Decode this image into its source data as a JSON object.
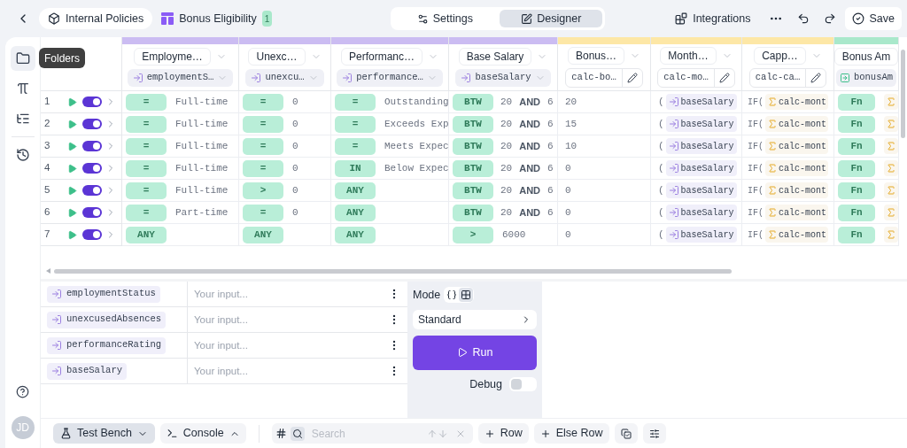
{
  "header": {
    "breadcrumbs": [
      {
        "label": "Internal Policies",
        "kind": "folder"
      },
      {
        "label": "Bonus Eligibility",
        "kind": "table",
        "badge": "1"
      }
    ],
    "tabs": [
      {
        "label": "Settings",
        "kind": "settings",
        "selected": false
      },
      {
        "label": "Designer",
        "kind": "designer",
        "selected": true
      }
    ],
    "integrations": "Integrations",
    "save": "Save"
  },
  "sidebar": {
    "items": [
      {
        "kind": "folder",
        "selected": true
      },
      {
        "kind": "pi",
        "selected": false
      },
      {
        "kind": "list",
        "selected": false
      },
      {
        "kind": "history",
        "selected": false
      }
    ],
    "tooltip": "Folders",
    "avatar": "JD"
  },
  "columns": [
    {
      "kind": "input",
      "title": "Employme…",
      "field": "employmentS…"
    },
    {
      "kind": "input",
      "title": "Unexc…",
      "field": "unexcu…"
    },
    {
      "kind": "input",
      "title": "Performanc…",
      "field": "performance…"
    },
    {
      "kind": "input",
      "title": "Base Salary",
      "field": "baseSalary"
    },
    {
      "kind": "calc",
      "title": "Bonus…",
      "field": "calc-bo…"
    },
    {
      "kind": "calc",
      "title": "Month…",
      "field": "calc-mo…"
    },
    {
      "kind": "calc",
      "title": "Capp…",
      "field": "calc-ca…"
    },
    {
      "kind": "output",
      "title": "Bonus Am",
      "field": "bonusAm"
    }
  ],
  "rows": [
    {
      "number": "1",
      "enabled": true,
      "cells": [
        {
          "kind": "condition",
          "op": "=",
          "value": "Full-time"
        },
        {
          "kind": "condition",
          "op": "=",
          "value": "0"
        },
        {
          "kind": "condition",
          "op": "=",
          "value": "Outstanding"
        },
        {
          "kind": "between",
          "op": "BTW",
          "low": "20",
          "joiner": "AND",
          "high": "6"
        },
        {
          "kind": "value",
          "value": "20"
        },
        {
          "kind": "reference",
          "prefix": "(",
          "chip": "baseSalary"
        },
        {
          "kind": "calc_reference",
          "prefix": "IF(",
          "chip": "calc-mont"
        },
        {
          "kind": "function",
          "op": "Fn"
        }
      ]
    },
    {
      "number": "2",
      "enabled": true,
      "cells": [
        {
          "kind": "condition",
          "op": "=",
          "value": "Full-time"
        },
        {
          "kind": "condition",
          "op": "=",
          "value": "0"
        },
        {
          "kind": "condition",
          "op": "=",
          "value": "Exceeds Exp"
        },
        {
          "kind": "between",
          "op": "BTW",
          "low": "20",
          "joiner": "AND",
          "high": "6"
        },
        {
          "kind": "value",
          "value": "15"
        },
        {
          "kind": "reference",
          "prefix": "(",
          "chip": "baseSalary"
        },
        {
          "kind": "calc_reference",
          "prefix": "IF(",
          "chip": "calc-mont"
        },
        {
          "kind": "function",
          "op": "Fn"
        }
      ]
    },
    {
      "number": "3",
      "enabled": true,
      "cells": [
        {
          "kind": "condition",
          "op": "=",
          "value": "Full-time"
        },
        {
          "kind": "condition",
          "op": "=",
          "value": "0"
        },
        {
          "kind": "condition",
          "op": "=",
          "value": "Meets Expec"
        },
        {
          "kind": "between",
          "op": "BTW",
          "low": "20",
          "joiner": "AND",
          "high": "6"
        },
        {
          "kind": "value",
          "value": "10"
        },
        {
          "kind": "reference",
          "prefix": "(",
          "chip": "baseSalary"
        },
        {
          "kind": "calc_reference",
          "prefix": "IF(",
          "chip": "calc-mont"
        },
        {
          "kind": "function",
          "op": "Fn"
        }
      ]
    },
    {
      "number": "4",
      "enabled": true,
      "cells": [
        {
          "kind": "condition",
          "op": "=",
          "value": "Full-time"
        },
        {
          "kind": "condition",
          "op": "=",
          "value": "0"
        },
        {
          "kind": "condition",
          "op": "IN",
          "value": "Below Expec"
        },
        {
          "kind": "between",
          "op": "BTW",
          "low": "20",
          "joiner": "AND",
          "high": "6"
        },
        {
          "kind": "value",
          "value": "0"
        },
        {
          "kind": "reference",
          "prefix": "(",
          "chip": "baseSalary"
        },
        {
          "kind": "calc_reference",
          "prefix": "IF(",
          "chip": "calc-mont"
        },
        {
          "kind": "function",
          "op": "Fn"
        }
      ]
    },
    {
      "number": "5",
      "enabled": true,
      "cells": [
        {
          "kind": "condition",
          "op": "=",
          "value": "Full-time"
        },
        {
          "kind": "condition",
          "op": ">",
          "value": "0"
        },
        {
          "kind": "condition",
          "op": "ANY"
        },
        {
          "kind": "between",
          "op": "BTW",
          "low": "20",
          "joiner": "AND",
          "high": "6"
        },
        {
          "kind": "value",
          "value": "0"
        },
        {
          "kind": "reference",
          "prefix": "(",
          "chip": "baseSalary"
        },
        {
          "kind": "calc_reference",
          "prefix": "IF(",
          "chip": "calc-mont"
        },
        {
          "kind": "function",
          "op": "Fn"
        }
      ]
    },
    {
      "number": "6",
      "enabled": true,
      "cells": [
        {
          "kind": "condition",
          "op": "=",
          "value": "Part-time"
        },
        {
          "kind": "condition",
          "op": "=",
          "value": "0"
        },
        {
          "kind": "condition",
          "op": "ANY"
        },
        {
          "kind": "between",
          "op": "BTW",
          "low": "20",
          "joiner": "AND",
          "high": "6"
        },
        {
          "kind": "value",
          "value": "0"
        },
        {
          "kind": "reference",
          "prefix": "(",
          "chip": "baseSalary"
        },
        {
          "kind": "calc_reference",
          "prefix": "IF(",
          "chip": "calc-mont"
        },
        {
          "kind": "function",
          "op": "Fn"
        }
      ]
    },
    {
      "number": "7",
      "enabled": true,
      "cells": [
        {
          "kind": "condition",
          "op": "ANY"
        },
        {
          "kind": "condition",
          "op": "ANY"
        },
        {
          "kind": "condition",
          "op": "ANY"
        },
        {
          "kind": "condition",
          "op": ">",
          "value": "6000"
        },
        {
          "kind": "value",
          "value": "0"
        },
        {
          "kind": "reference",
          "prefix": "(",
          "chip": "baseSalary"
        },
        {
          "kind": "calc_reference",
          "prefix": "IF(",
          "chip": "calc-mont"
        },
        {
          "kind": "function",
          "op": "Fn"
        }
      ]
    }
  ],
  "test_inputs": [
    {
      "name": "employmentStatus",
      "placeholder": "Your input..."
    },
    {
      "name": "unexcusedAbsences",
      "placeholder": "Your input..."
    },
    {
      "name": "performanceRating",
      "placeholder": "Your input..."
    },
    {
      "name": "baseSalary",
      "placeholder": "Your input..."
    }
  ],
  "run_panel": {
    "mode_label": "Mode",
    "modes": [
      {
        "kind": "json",
        "selected": false
      },
      {
        "kind": "table",
        "selected": true
      }
    ],
    "preset": "Standard",
    "run": "Run",
    "debug_label": "Debug",
    "debug_on": false
  },
  "footer": {
    "test_bench": "Test Bench",
    "console": "Console",
    "search_placeholder": "Search",
    "add_row": "Row",
    "add_else_row": "Else Row"
  }
}
